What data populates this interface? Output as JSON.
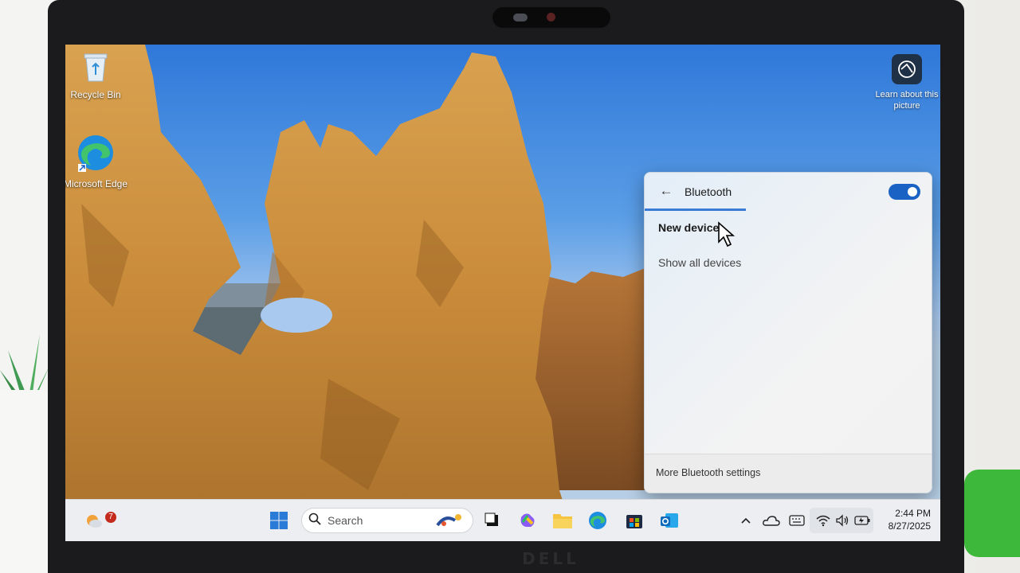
{
  "desktop": {
    "icons": [
      {
        "label": "Recycle Bin",
        "icon": "recycle-bin-icon"
      },
      {
        "label": "Microsoft Edge",
        "icon": "edge-icon"
      }
    ],
    "learn_picture": {
      "label": "Learn about this picture",
      "icon": "camera-icon"
    }
  },
  "bluetooth_flyout": {
    "title": "Bluetooth",
    "toggle_on": true,
    "items": [
      {
        "label": "New device"
      },
      {
        "label": "Show all devices"
      }
    ],
    "footer_link": "More Bluetooth settings"
  },
  "taskbar": {
    "widgets_badge": "7",
    "search_placeholder": "Search",
    "pinned_apps": [
      "task-view-icon",
      "copilot-icon",
      "file-explorer-icon",
      "edge-icon",
      "microsoft-store-icon",
      "outlook-icon"
    ],
    "tray_icons": [
      "chevron-up-icon",
      "onedrive-icon",
      "keyboard-icon",
      "wifi-icon",
      "volume-icon",
      "battery-icon"
    ],
    "time": "2:44 PM",
    "date": "8/27/2025"
  },
  "colors": {
    "accent": "#1a62c4",
    "taskbar_bg": "#eceef1",
    "flyout_bg": "#f2f2f2"
  }
}
